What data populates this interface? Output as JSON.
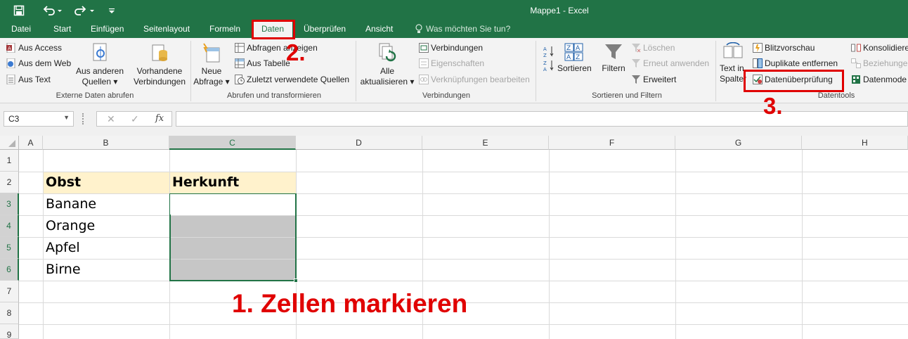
{
  "window": {
    "title": "Mappe1 - Excel"
  },
  "quick_access": {
    "save_icon": "save-icon",
    "undo_icon": "undo-icon",
    "redo_icon": "redo-icon",
    "customize_icon": "customize-qat-icon"
  },
  "tabs": [
    "Datei",
    "Start",
    "Einfügen",
    "Seitenlayout",
    "Formeln",
    "Daten",
    "Überprüfen",
    "Ansicht"
  ],
  "active_tab": "Daten",
  "tell_me": "Was möchten Sie tun?",
  "ribbon": {
    "external": {
      "access": "Aus Access",
      "web": "Aus dem Web",
      "text": "Aus Text",
      "other_1": "Aus anderen",
      "other_2": "Quellen",
      "existing_1": "Vorhandene",
      "existing_2": "Verbindungen",
      "group": "Externe Daten abrufen"
    },
    "retrieve": {
      "new_query_1": "Neue",
      "new_query_2": "Abfrage",
      "show_queries": "Abfragen anzeigen",
      "from_table": "Aus Tabelle",
      "recent": "Zuletzt verwendete Quellen",
      "group": "Abrufen und transformieren"
    },
    "connections": {
      "refresh_1": "Alle",
      "refresh_2": "aktualisieren",
      "connections": "Verbindungen",
      "properties": "Eigenschaften",
      "edit_links": "Verknüpfungen bearbeiten",
      "group": "Verbindungen"
    },
    "sort": {
      "sort": "Sortieren",
      "filter": "Filtern",
      "clear": "Löschen",
      "reapply": "Erneut anwenden",
      "advanced": "Erweitert",
      "group": "Sortieren und Filtern"
    },
    "tools": {
      "text_to_cols_1": "Text in",
      "text_to_cols_2": "Spalten",
      "flash_fill": "Blitzvorschau",
      "remove_dup": "Duplikate entfernen",
      "validation": "Datenüberprüfung",
      "consolidate": "Konsolidiere",
      "relationships": "Beziehunge",
      "data_model": "Datenmode",
      "group": "Datentools"
    }
  },
  "formula_bar": {
    "name_box": "C3",
    "fx": "fx",
    "cancel_icon": "cancel-icon",
    "enter_icon": "enter-icon",
    "value": ""
  },
  "columns": [
    "A",
    "B",
    "C",
    "D",
    "E",
    "F",
    "G",
    "H"
  ],
  "rows": [
    "1",
    "2",
    "3",
    "4",
    "5",
    "6",
    "7",
    "8",
    "9"
  ],
  "cells": {
    "B2": "Obst",
    "C2": "Herkunft",
    "B3": "Banane",
    "B4": "Orange",
    "B5": "Apfel",
    "B6": "Birne"
  },
  "annotations": {
    "step1": "1. Zellen markieren",
    "step2": "2.",
    "step3": "3."
  },
  "colors": {
    "excel_green": "#217346",
    "annotation_red": "#e00000",
    "header_fill": "#fff2cc",
    "selection_fill": "#c6c6c6"
  }
}
